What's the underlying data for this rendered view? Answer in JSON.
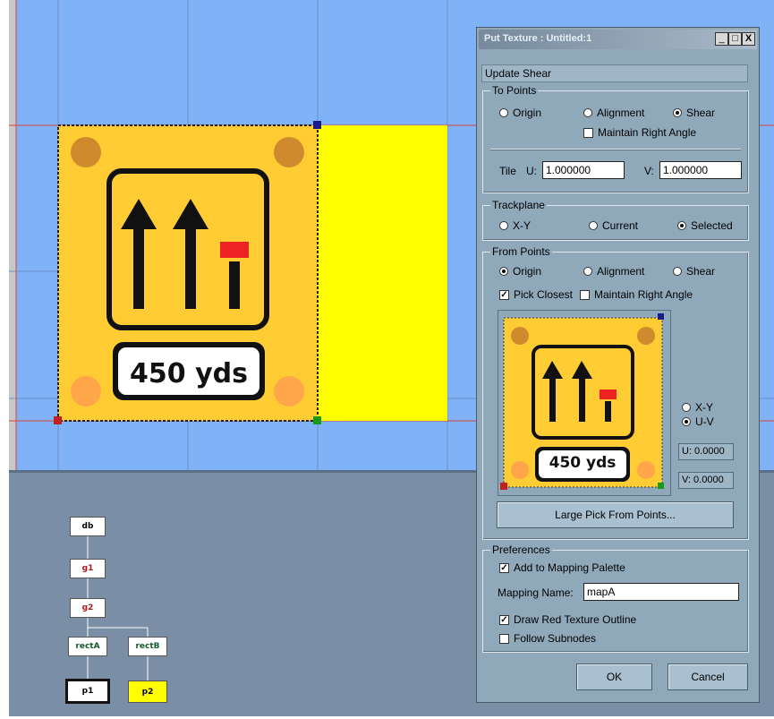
{
  "dialog": {
    "title": "Put Texture : Untitled:1",
    "mode_label": "Update Shear",
    "to_points": {
      "label": "To Points",
      "origin": "Origin",
      "alignment": "Alignment",
      "shear": "Shear",
      "selected": "shear",
      "maintain_right_angle": "Maintain Right Angle",
      "maintain_right_angle_checked": false
    },
    "tile": {
      "label": "Tile",
      "u_label": "U:",
      "u_value": "1.000000",
      "v_label": "V:",
      "v_value": "1.000000"
    },
    "trackplane": {
      "label": "Trackplane",
      "xy": "X-Y",
      "current": "Current",
      "selected_option": "Selected",
      "selected": "selected"
    },
    "from_points": {
      "label": "From Points",
      "origin": "Origin",
      "alignment": "Alignment",
      "shear": "Shear",
      "selected": "origin",
      "pick_closest": "Pick Closest",
      "pick_closest_checked": true,
      "maintain_right_angle": "Maintain Right Angle",
      "maintain_right_angle_checked": false,
      "preview_sign_text": "450 yds",
      "xy": "X-Y",
      "uv": "U-V",
      "coord_mode": "uv",
      "u_readout": "U: 0.0000",
      "v_readout": "V: 0.0000",
      "large_pick_button": "Large Pick From Points..."
    },
    "preferences": {
      "label": "Preferences",
      "add_to_palette": "Add to Mapping Palette",
      "add_to_palette_checked": true,
      "mapping_name_label": "Mapping Name:",
      "mapping_name_value": "mapA",
      "draw_red_outline": "Draw Red Texture Outline",
      "draw_red_outline_checked": true,
      "follow_subnodes": "Follow Subnodes",
      "follow_subnodes_checked": false
    },
    "ok_button": "OK",
    "cancel_button": "Cancel",
    "minimize_glyph": "_",
    "maximize_glyph": "□",
    "close_glyph": "X"
  },
  "viewport": {
    "sign_text": "450 yds",
    "colors": {
      "background": "#7fb2f7",
      "sign": "#ffcc33",
      "neighbor_rect": "#ffff00",
      "dot_brown": "#d08a2e",
      "dot_light": "#ffa64a",
      "red_bar": "#ee2222"
    }
  },
  "tree": {
    "nodes": {
      "db": "db",
      "g1": "g1",
      "g2": "g2",
      "rectA": "rectA",
      "rectB": "rectB",
      "p1": "p1",
      "p2": "p2"
    }
  }
}
